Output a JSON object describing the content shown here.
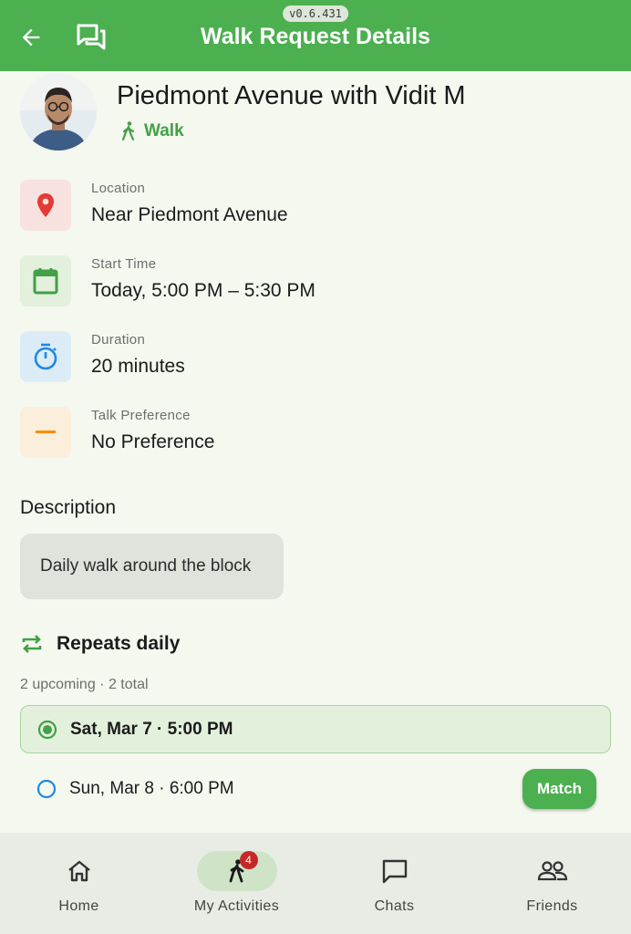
{
  "app": {
    "version": "v0.6.431",
    "title": "Walk Request Details"
  },
  "walk": {
    "title": "Piedmont Avenue with Vidit M",
    "type": "Walk"
  },
  "details": [
    {
      "label": "Location",
      "value": "Near Piedmont Avenue",
      "icon": "location-pin-icon",
      "color": "#e53935"
    },
    {
      "label": "Start Time",
      "value": "Today, 5:00 PM – 5:30 PM",
      "icon": "calendar-icon",
      "color": "#43a047"
    },
    {
      "label": "Duration",
      "value": "20 minutes",
      "icon": "timer-icon",
      "color": "#1e88e5"
    },
    {
      "label": "Talk Preference",
      "value": "No Preference",
      "icon": "dash-icon",
      "color": "#fb8c00"
    }
  ],
  "description": {
    "heading": "Description",
    "text": "Daily walk around the block"
  },
  "repeat": {
    "label": "Repeats daily",
    "summary": "2 upcoming · 2 total"
  },
  "occurrences": [
    {
      "text": "Sat, Mar 7 · 5:00 PM",
      "selected": true
    },
    {
      "text": "Sun, Mar 8 · 6:00 PM",
      "selected": false,
      "action": "Match"
    }
  ],
  "nav": {
    "items": [
      {
        "label": "Home",
        "icon": "home-icon"
      },
      {
        "label": "My Activities",
        "icon": "walking-person-icon",
        "badge": "4",
        "active": true
      },
      {
        "label": "Chats",
        "icon": "chat-bubble-icon"
      },
      {
        "label": "Friends",
        "icon": "people-icon"
      }
    ]
  },
  "colors": {
    "primary": "#4caf50",
    "background": "#f4f8ef"
  }
}
